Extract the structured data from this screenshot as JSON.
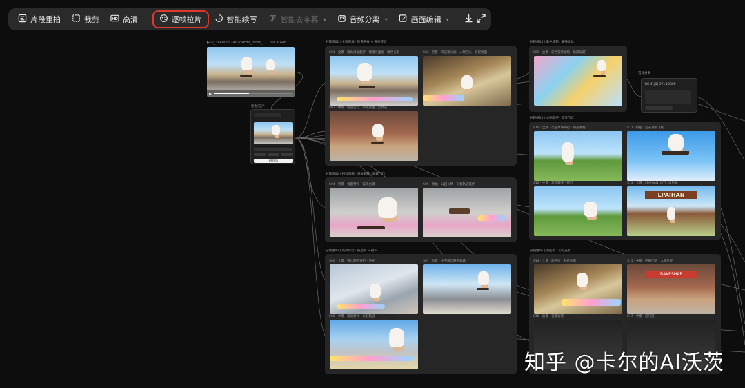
{
  "toolbar": {
    "items": [
      {
        "label": "片段重拍",
        "icon": "clip-reshoot-icon",
        "enabled": true
      },
      {
        "label": "裁剪",
        "icon": "crop-icon",
        "enabled": true
      },
      {
        "label": "高清",
        "icon": "hd-icon",
        "enabled": true
      },
      {
        "label": "逐帧拉片",
        "icon": "frame-by-frame-icon",
        "enabled": true,
        "highlighted": true
      },
      {
        "label": "智能续写",
        "icon": "smart-continue-icon",
        "enabled": true
      },
      {
        "label": "智能去字幕",
        "icon": "remove-subtitle-icon",
        "enabled": false,
        "dropdown": true
      },
      {
        "label": "音频分离",
        "icon": "audio-split-icon",
        "enabled": true,
        "dropdown": true
      },
      {
        "label": "画面编辑",
        "icon": "picture-edit-icon",
        "enabled": true,
        "dropdown": true
      }
    ],
    "download_icon": "download-icon",
    "fullscreen_icon": "fullscreen-icon",
    "highlight_color": "#e0382b"
  },
  "source_node": {
    "label": "▶ vi_3e6d0bd24d7d4cd9_https_...  1766 x 446"
  },
  "frame_node": {
    "label": "逐帧拉片",
    "button_label": "逐帧拉片"
  },
  "groups": [
    {
      "title": "分镜组01 | 主题表演 · 街道滑板 → 天桥转折",
      "captions": [
        "S01 · 全景 · 街角滑板起步 · 慢镜头推进 · 暖色光影",
        "S02 · 近景 · 商店街长廊 · 人物回头 · 彩虹地面",
        "S03 · 中景 · 街道前行 · 平稳跟拍 · 自然光"
      ]
    },
    {
      "title": "分镜组02 | 特效演绎 · 滑板翻转 · 跳跃飞行",
      "captions": [
        "S04 · 近景 · 板面特写 · 猫咪出镜",
        "S05 · 俯拍 · 公园长椅 · 彩虹轨迹延伸"
      ]
    },
    {
      "title": "分镜组03 | 城市穿行 · 铁丝网 → 街头",
      "captions": [
        "S06 · 全景 · 铁丝网后滑行 · 逆光",
        "S07 · 远景 · 十字路口腾空跳跃",
        "S08 · 中景 · 街道俯冲 · 彩虹轨迹"
      ]
    },
    {
      "title": "分镜组04 | 彩色涂鸦 · 猫咪墙绘",
      "captions": [
        "S09 · 全景 · 彩色猫咪墙绘 · 跳跃穿越"
      ]
    },
    {
      "title": "分镜组05 | 公园草坪 · 蓝天飞跃",
      "captions": [
        "S10 · 全景 · 公园草坪滑行 · 阳光明媚",
        "S11 · 仰拍 · 蓝天滑板飞跃",
        "S12 · 中景 · 草坪蹲姿 · 前行",
        "S13 · 全景 · LPAIHAN 大门 · 自然光"
      ]
    },
    {
      "title": "分镜组06 | 商店街 · 彩虹光影",
      "captions": [
        "S14 · 全景 · 商店街 · 彩虹地面",
        "S15 · 中景 · 店铺门前 · 人物驻足",
        "S16 · 近景 · 夜晚街景",
        "S17 · 中景 · 店门前"
      ]
    }
  ],
  "audio_node": {
    "label": "音频分离",
    "chip": "BGM分离  37s  1080P"
  },
  "sign_text": "LPAIHAN",
  "shop_sign": "BAKESHAP",
  "watermark": "知乎 @卡尔的AI沃茨"
}
